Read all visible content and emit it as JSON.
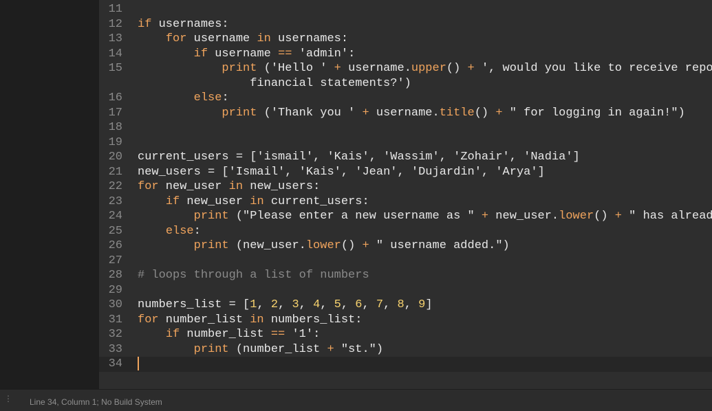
{
  "editor": {
    "lines": [
      {
        "num": "11",
        "code": ""
      },
      {
        "num": "12",
        "code": "if usernames:"
      },
      {
        "num": "13",
        "code": "    for username in usernames:"
      },
      {
        "num": "14",
        "code": "        if username == 'admin':"
      },
      {
        "num": "15",
        "code": "            print ('Hello ' + username.upper() + ', would you like to receive reports"
      },
      {
        "num": "",
        "code": "                financial statements?')"
      },
      {
        "num": "16",
        "code": "        else:"
      },
      {
        "num": "17",
        "code": "            print ('Thank you ' + username.title() + \" for logging in again!\")"
      },
      {
        "num": "18",
        "code": ""
      },
      {
        "num": "19",
        "code": ""
      },
      {
        "num": "20",
        "code": "current_users = ['ismail', 'Kais', 'Wassim', 'Zohair', 'Nadia']"
      },
      {
        "num": "21",
        "code": "new_users = ['Ismail', 'Kais', 'Jean', 'Dujardin', 'Arya']"
      },
      {
        "num": "22",
        "code": "for new_user in new_users:"
      },
      {
        "num": "23",
        "code": "    if new_user in current_users:"
      },
      {
        "num": "24",
        "code": "        print (\"Please enter a new username as \" + new_user.lower() + \" has already b"
      },
      {
        "num": "25",
        "code": "    else:"
      },
      {
        "num": "26",
        "code": "        print (new_user.lower() + \" username added.\")"
      },
      {
        "num": "27",
        "code": ""
      },
      {
        "num": "28",
        "code": "# loops through a list of numbers"
      },
      {
        "num": "29",
        "code": ""
      },
      {
        "num": "30",
        "code": "numbers_list = [1, 2, 3, 4, 5, 6, 7, 8, 9]"
      },
      {
        "num": "31",
        "code": "for number_list in numbers_list:"
      },
      {
        "num": "32",
        "code": "    if number_list == '1':"
      },
      {
        "num": "33",
        "code": "        print (number_list + \"st.\")"
      },
      {
        "num": "34",
        "code": ""
      }
    ],
    "active_line": "34"
  },
  "statusbar": {
    "text": "Line 34, Column 1; No Build System",
    "grip_icon": "vertical-dots-icon"
  },
  "colors": {
    "keyword": "#f0a45d",
    "number": "#f7d26e",
    "comment": "#8a8a8a",
    "text": "#e8e8e8",
    "background": "#2e2e2e"
  }
}
